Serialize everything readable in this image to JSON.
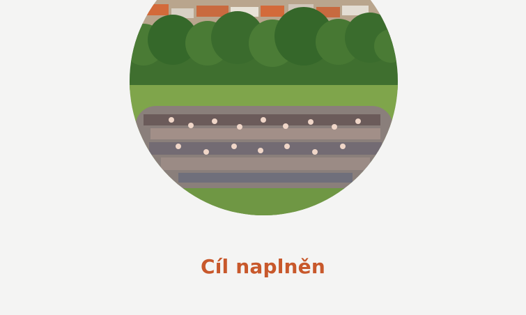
{
  "status": {
    "title": "Cíl naplněn",
    "title_color": "#c8582b"
  },
  "photo": {
    "kind": "group-photo-crowd-on-meadow",
    "shape": "circle"
  },
  "colors": {
    "background": "#f4f4f3",
    "grass": "#7fa54b",
    "trees": "#3f6f2f",
    "roofs": "#d36a3a"
  }
}
